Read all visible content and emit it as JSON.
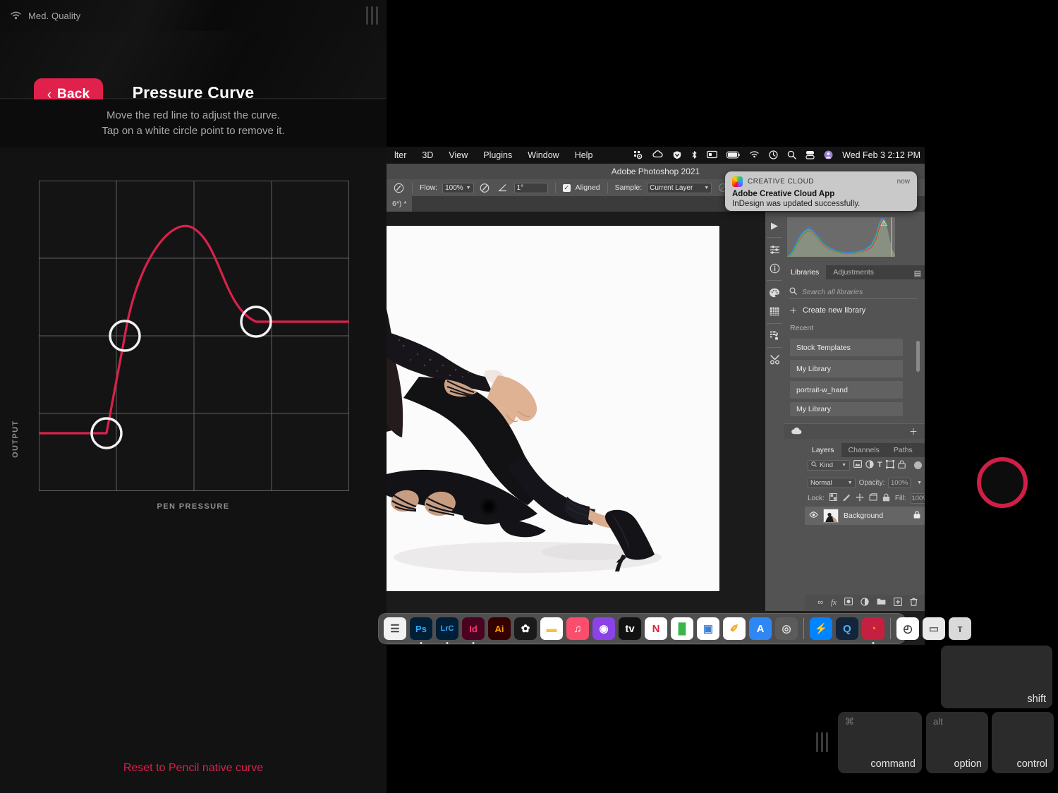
{
  "left_panel": {
    "status": {
      "quality_label": "Med. Quality",
      "wifi_icon": "wifi-icon"
    },
    "header": {
      "back_label": "Back",
      "back_chevron": "‹",
      "title": "Pressure Curve"
    },
    "instructions": {
      "line1": "Move the red line to adjust the curve.",
      "line2": "Tap on a white circle point to remove it."
    },
    "graph": {
      "y_axis": "OUTPUT",
      "x_axis": "PEN PRESSURE"
    },
    "reset_label": "Reset to Pencil native curve",
    "accent_color": "#e0214c",
    "curve_color": "#d9214b"
  },
  "chart_data": {
    "type": "line",
    "title": "Pressure Curve",
    "xlabel": "PEN PRESSURE",
    "ylabel": "OUTPUT",
    "xlim": [
      0,
      1
    ],
    "ylim": [
      0,
      1
    ],
    "grid": true,
    "grid_divisions": 4,
    "series": [
      {
        "name": "pressure-response",
        "x": [
          0.0,
          0.22,
          0.275,
          0.34,
          0.42,
          0.5,
          0.58,
          0.65,
          0.7,
          0.73,
          1.0
        ],
        "y": [
          0.095,
          0.095,
          0.2,
          0.5,
          0.78,
          0.875,
          0.83,
          0.68,
          0.56,
          0.545,
          0.545
        ]
      }
    ],
    "control_points": [
      {
        "name": "point-1",
        "x": 0.22,
        "y": 0.095
      },
      {
        "name": "point-2",
        "x": 0.275,
        "y": 0.5
      },
      {
        "name": "point-3",
        "x": 0.72,
        "y": 0.545
      }
    ]
  },
  "macos": {
    "menus": [
      "lter",
      "3D",
      "View",
      "Plugins",
      "Window",
      "Help"
    ],
    "status_icons": [
      "airdrop-icon",
      "creative-cloud-icon",
      "malwarebytes-icon",
      "bluetooth-icon",
      "display-icon",
      "battery-icon",
      "wifi-icon",
      "timemachine-icon",
      "search-icon",
      "controlcenter-icon",
      "user-avatar-icon"
    ],
    "clock": "Wed Feb 3  2:12 PM"
  },
  "photoshop": {
    "window_title": "Adobe Photoshop 2021",
    "options_bar": {
      "brush_icon": "brush-preset-icon",
      "flow_label": "Flow:",
      "flow_value": "100%",
      "airbrush_icon": "airbrush-icon",
      "angle_icon": "angle-icon",
      "angle_value": "1°",
      "aligned_label": "Aligned",
      "aligned_checked": true,
      "sample_label": "Sample:",
      "sample_value": "Current Layer",
      "adjustment_icon": "ignore-adjustment-icon",
      "tablet_icon": "tablet-pressure-icon"
    },
    "document_tab": "6*) *",
    "rail_icons": [
      "play-icon",
      "sliders-icon",
      "info-icon",
      "palette-icon",
      "grid-icon",
      "history-brush-icon",
      "tools-icon"
    ],
    "libraries_panel": {
      "tabs": [
        {
          "label": "Libraries",
          "active": true
        },
        {
          "label": "Adjustments",
          "active": false
        }
      ],
      "search_placeholder": "Search all libraries",
      "search_icon": "search-icon",
      "create_label": "Create new library",
      "create_icon": "plus-icon",
      "recent_label": "Recent",
      "items": [
        "Stock Templates",
        "My Library",
        "portrait-w_hand",
        "My Library"
      ],
      "footer_left_icon": "cloud-icon",
      "footer_right_icon": "add-icon"
    },
    "layers_panel": {
      "tabs": [
        {
          "label": "Layers",
          "active": true
        },
        {
          "label": "Channels",
          "active": false
        },
        {
          "label": "Paths",
          "active": false
        }
      ],
      "filter_label": "Kind",
      "filter_icons": [
        "image-filter-icon",
        "adjustment-filter-icon",
        "type-filter-icon",
        "shape-filter-icon",
        "smartobject-filter-icon"
      ],
      "blend_mode": "Normal",
      "opacity_label": "Opacity:",
      "opacity_value": "100%",
      "lock_label": "Lock:",
      "lock_icons": [
        "lock-transparent-icon",
        "lock-image-icon",
        "lock-position-icon",
        "lock-artboard-icon",
        "lock-all-icon"
      ],
      "fill_label": "Fill:",
      "fill_value": "100%",
      "rows": [
        {
          "name": "Background",
          "visible": true,
          "locked": true,
          "eye_icon": "eye-icon",
          "lock_icon": "lock-icon"
        }
      ],
      "footer_icons": [
        "link-icon",
        "fx-icon",
        "mask-icon",
        "adjustment-icon",
        "group-icon",
        "new-layer-icon",
        "delete-icon"
      ]
    },
    "notification": {
      "brand": "CREATIVE CLOUD",
      "time": "now",
      "title": "Adobe Creative Cloud App",
      "body": "InDesign was updated successfully.",
      "logo_icon": "creative-cloud-logo-icon"
    },
    "dock_items": [
      {
        "name": "finder-icon",
        "label": "",
        "bg": "#f2f2f2",
        "fg": "#444",
        "glyph": "☰",
        "running": false
      },
      {
        "name": "photoshop-icon",
        "label": "Ps",
        "bg": "#001e36",
        "fg": "#31a8ff",
        "glyph": "Ps",
        "running": true
      },
      {
        "name": "lightroom-classic-icon",
        "label": "LrC",
        "bg": "#001e36",
        "fg": "#31a8ff",
        "glyph": "LrC",
        "running": true
      },
      {
        "name": "indesign-icon",
        "label": "Id",
        "bg": "#49021f",
        "fg": "#ff3366",
        "glyph": "Id",
        "running": true
      },
      {
        "name": "illustrator-icon",
        "label": "Ai",
        "bg": "#330000",
        "fg": "#ff9a00",
        "glyph": "Ai",
        "running": false
      },
      {
        "name": "photos-icon",
        "label": "",
        "bg": "#1a1a1a",
        "fg": "#fff",
        "glyph": "✿",
        "running": false
      },
      {
        "name": "notes-icon",
        "label": "",
        "bg": "#ffffff",
        "fg": "#f5c144",
        "glyph": "▬",
        "running": false
      },
      {
        "name": "music-icon",
        "label": "",
        "bg": "#fb4e6d",
        "fg": "#fff",
        "glyph": "♫",
        "running": false
      },
      {
        "name": "podcasts-icon",
        "label": "",
        "bg": "#8b43e8",
        "fg": "#fff",
        "glyph": "◉",
        "running": false
      },
      {
        "name": "appletv-icon",
        "label": "",
        "bg": "#111111",
        "fg": "#fff",
        "glyph": "tv",
        "running": false
      },
      {
        "name": "news-icon",
        "label": "",
        "bg": "#ffffff",
        "fg": "#e5203c",
        "glyph": "N",
        "running": false
      },
      {
        "name": "numbers-icon",
        "label": "",
        "bg": "#ffffff",
        "fg": "#39b54a",
        "glyph": "█",
        "running": false
      },
      {
        "name": "keynote-icon",
        "label": "",
        "bg": "#ffffff",
        "fg": "#3b7fd4",
        "glyph": "▣",
        "running": false
      },
      {
        "name": "pages-icon",
        "label": "",
        "bg": "#ffffff",
        "fg": "#f5a623",
        "glyph": "✐",
        "running": false
      },
      {
        "name": "appstore-icon",
        "label": "",
        "bg": "#2f87f3",
        "fg": "#fff",
        "glyph": "A",
        "running": false
      },
      {
        "name": "settings-icon",
        "label": "",
        "bg": "#5b5b5b",
        "fg": "#ddd",
        "glyph": "◎",
        "running": false
      },
      {
        "name": "messenger-icon",
        "label": "",
        "bg": "#0084ff",
        "fg": "#fff",
        "glyph": "⚡",
        "running": false
      },
      {
        "name": "quicktime-icon",
        "label": "",
        "bg": "#14243a",
        "fg": "#4ab3f4",
        "glyph": "Q",
        "running": false
      },
      {
        "name": "firefox-icon",
        "label": "",
        "bg": "#c5203f",
        "fg": "#ff9500",
        "glyph": "◔",
        "running": true
      },
      {
        "name": "preview-icon",
        "label": "",
        "bg": "#ffffff",
        "fg": "#333",
        "glyph": "◴",
        "running": false
      },
      {
        "name": "downloads-icon",
        "label": "",
        "bg": "#e9e9e9",
        "fg": "#666",
        "glyph": "▭",
        "running": false
      },
      {
        "name": "trash-icon",
        "label": "",
        "bg": "#d9d9d9",
        "fg": "#555",
        "glyph": "ᴛ",
        "running": false
      }
    ]
  },
  "overlay": {
    "record_button": "record-button",
    "record_color": "#cf1f46",
    "modifier_keys": [
      {
        "name": "shift-key",
        "label": "shift",
        "symbol": ""
      },
      {
        "name": "command-key",
        "label": "command",
        "symbol": "⌘"
      },
      {
        "name": "option-key",
        "label": "option",
        "symbol": "alt"
      },
      {
        "name": "control-key",
        "label": "control",
        "symbol": ""
      }
    ],
    "keyboard_grip": "drag-handle-icon"
  }
}
